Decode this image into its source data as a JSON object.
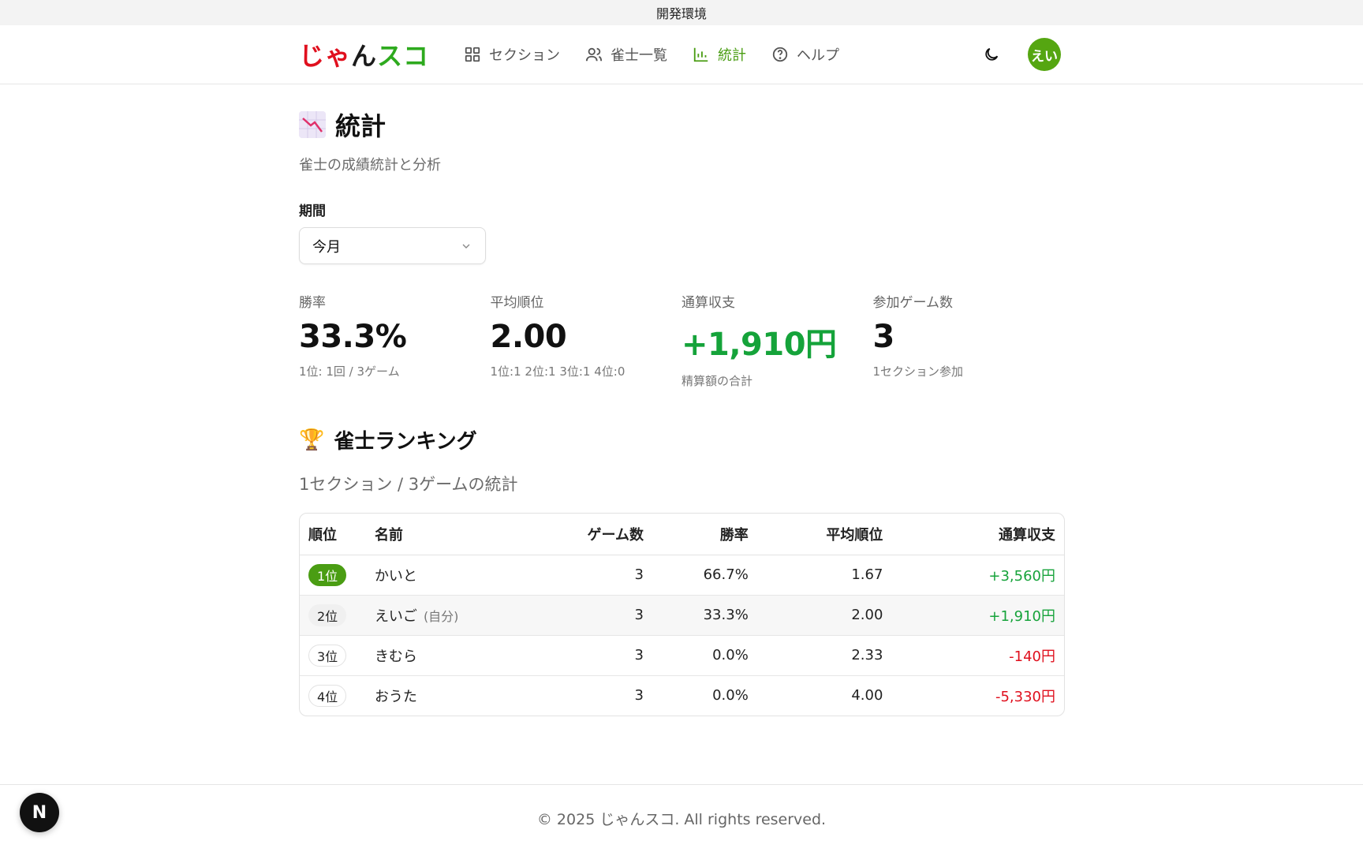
{
  "env_label": "開発環境",
  "logo": {
    "part1": "じゃ",
    "part2": "ん",
    "part3": "スコ"
  },
  "nav": [
    {
      "label": "セクション",
      "icon": "grid-icon",
      "active": false
    },
    {
      "label": "雀士一覧",
      "icon": "users-icon",
      "active": false
    },
    {
      "label": "統計",
      "icon": "bar-chart-icon",
      "active": true
    },
    {
      "label": "ヘルプ",
      "icon": "help-circle-icon",
      "active": false
    }
  ],
  "user": {
    "avatar_text": "えい"
  },
  "page": {
    "title": "統計",
    "subtitle": "雀士の成績統計と分析"
  },
  "period": {
    "label": "期間",
    "selected": "今月"
  },
  "stats": [
    {
      "label": "勝率",
      "value": "33.3%",
      "sub": "1位: 1回 / 3ゲーム",
      "tone": "normal"
    },
    {
      "label": "平均順位",
      "value": "2.00",
      "sub": "1位:1 2位:1 3位:1 4位:0",
      "tone": "normal"
    },
    {
      "label": "通算収支",
      "value": "+1,910円",
      "sub": "精算額の合計",
      "tone": "positive"
    },
    {
      "label": "参加ゲーム数",
      "value": "3",
      "sub": "1セクション参加",
      "tone": "normal"
    }
  ],
  "ranking": {
    "title": "雀士ランキング",
    "subtitle": "1セクション / 3ゲームの統計",
    "columns": [
      "順位",
      "名前",
      "ゲーム数",
      "勝率",
      "平均順位",
      "通算収支"
    ],
    "rows": [
      {
        "rank": "1位",
        "name": "かいと",
        "self_tag": "",
        "games": "3",
        "win_rate": "66.7%",
        "avg_rank": "1.67",
        "balance": "+3,560円",
        "balance_sign": "pos"
      },
      {
        "rank": "2位",
        "name": "えいご",
        "self_tag": "(自分)",
        "games": "3",
        "win_rate": "33.3%",
        "avg_rank": "2.00",
        "balance": "+1,910円",
        "balance_sign": "pos"
      },
      {
        "rank": "3位",
        "name": "きむら",
        "self_tag": "",
        "games": "3",
        "win_rate": "0.0%",
        "avg_rank": "2.33",
        "balance": "-140円",
        "balance_sign": "neg"
      },
      {
        "rank": "4位",
        "name": "おうた",
        "self_tag": "",
        "games": "3",
        "win_rate": "0.0%",
        "avg_rank": "4.00",
        "balance": "-5,330円",
        "balance_sign": "neg"
      }
    ]
  },
  "footer": {
    "text": "© 2025 じゃんスコ. All rights reserved."
  },
  "dev_button": {
    "label": "N"
  }
}
